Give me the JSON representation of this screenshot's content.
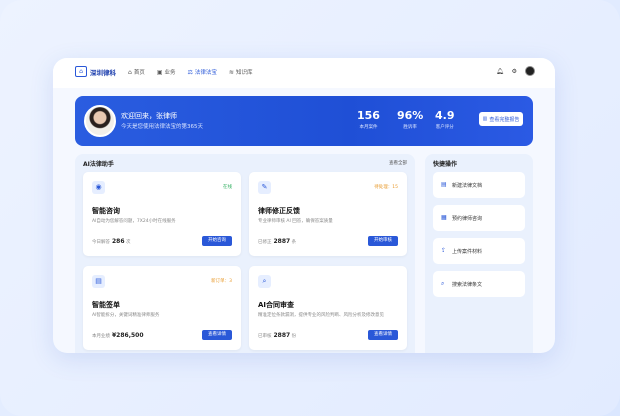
{
  "nav": {
    "logo": "深圳律科",
    "items": [
      {
        "label": "首页",
        "icon": "home-icon",
        "glyph": "⌂"
      },
      {
        "label": "业务",
        "icon": "briefcase-icon",
        "glyph": "▣"
      },
      {
        "label": "法律法宝",
        "icon": "gavel-icon",
        "glyph": "⚖"
      },
      {
        "label": "知识库",
        "icon": "graduation-cap-icon",
        "glyph": "≋"
      }
    ]
  },
  "banner": {
    "welcome": "欢迎回来，张律师",
    "subtitle": "今天是您使用法律法宝的第365天",
    "stats": [
      {
        "value": "156",
        "label": "本月案件"
      },
      {
        "value": "96%",
        "label": "胜诉率"
      },
      {
        "value": "4.9",
        "label": "客户评分"
      }
    ],
    "report_button": "查看完整报告"
  },
  "assistant": {
    "title": "AI法律助手",
    "view_all": "查看全部",
    "cards": [
      {
        "title": "智能咨询",
        "desc": "AI自动为您解答问题，7X24小时在线服务",
        "tag": "在线",
        "tag_color": "#2fae5f",
        "meta_label": "今日解答",
        "meta_value": "286",
        "meta_unit": "次",
        "button": "开始咨询"
      },
      {
        "title": "律师修正反馈",
        "desc": "专业律师审核 AI 回答，确保答案质量",
        "tag": "待处理：15",
        "tag_color": "#e89a2c",
        "meta_label": "已修正",
        "meta_value": "2887",
        "meta_unit": "条",
        "button": "开始审核"
      },
      {
        "title": "智能签单",
        "desc": "AI智能拆分，关键词精准律师服务",
        "tag": "新订单：3",
        "tag_color": "#e89a2c",
        "meta_label": "本月业绩",
        "meta_value": "¥286,500",
        "meta_unit": "",
        "button": "查看详情"
      },
      {
        "title": "AI合同审查",
        "desc": "精准定位条款漏洞，提供专业的风险判断、风险分析及修改意见",
        "tag": "",
        "tag_color": "#e89a2c",
        "meta_label": "已审核",
        "meta_value": "2887",
        "meta_unit": "份",
        "button": "查看详情"
      }
    ]
  },
  "quick": {
    "title": "快捷操作",
    "items": [
      {
        "label": "新建法律文档",
        "icon": "document-add-icon",
        "glyph": "▤"
      },
      {
        "label": "预约律师咨询",
        "icon": "calendar-icon",
        "glyph": "▦"
      },
      {
        "label": "上传案件材料",
        "icon": "upload-icon",
        "glyph": "⇪"
      },
      {
        "label": "搜索法律条文",
        "icon": "search-icon",
        "glyph": "⌕"
      }
    ]
  }
}
